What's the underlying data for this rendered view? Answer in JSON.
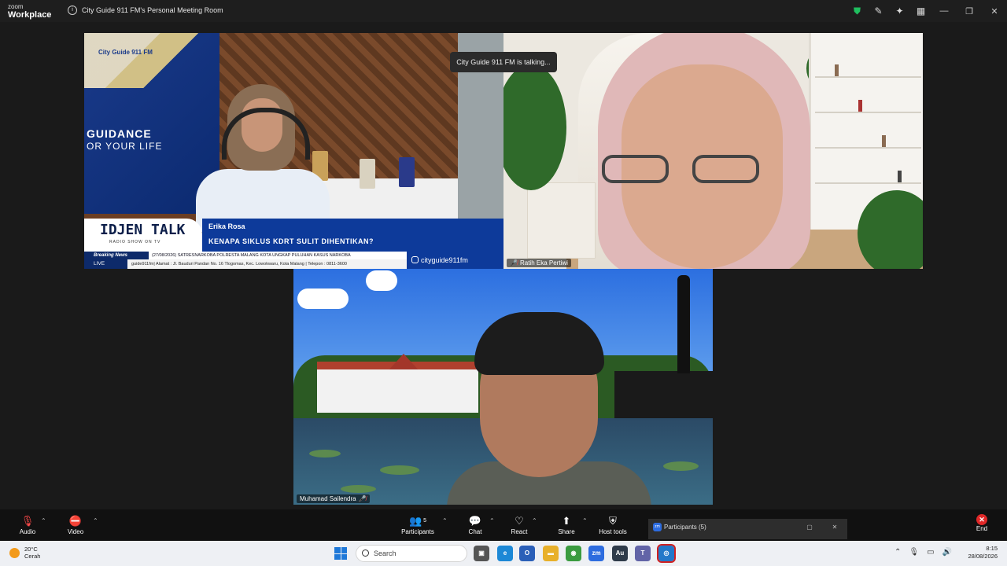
{
  "app": {
    "logo_line1": "zoom",
    "logo_line2": "Workplace",
    "meeting_title": "City Guide 911 FM's Personal Meeting Room"
  },
  "toast": {
    "text": "City Guide 911 FM is talking..."
  },
  "tiles": [
    {
      "name": "",
      "overlay": {
        "banner_brand": "City Guide 911 FM",
        "banner_line1": "GUIDANCE",
        "banner_line2": "OR YOUR LIFE",
        "show_logo": "IDJEN TALK",
        "show_sub": "RADIO SHOW ON TV",
        "speaker": "Erika Rosa",
        "topic": "KENAPA SIKLUS KDRT SULIT DIHENTIKAN?",
        "breaking_label": "Breaking News",
        "ticker1": "(27/08/2026) SATRESNARKOBA POLRESTA MALANG KOTA UNGKAP PULUHAN KASUS NARKOBA",
        "ticker2": "guide911fm| Alamat : Jl. Bauduri Pandan No. 16 Tlogomas, Kec. Lowokwaru, Kota Malang | Telepon : 0811-3600",
        "live_label": "LIVE",
        "social": "cityguide911fm"
      }
    },
    {
      "name": "Ratih Eka Pertiwi",
      "muted": true
    },
    {
      "name": "Muhamad Sailendra",
      "muted": true
    }
  ],
  "controls": {
    "audio": "Audio",
    "video": "Video",
    "participants": "Participants",
    "participants_count": "5",
    "chat": "Chat",
    "react": "React",
    "share": "Share",
    "host_tools": "Host tools",
    "end": "End"
  },
  "participants_panel": {
    "title": "Participants (5)"
  },
  "taskbar": {
    "temperature": "20°C",
    "condition": "Cerah",
    "search_placeholder": "Search",
    "time": "8:15",
    "date": "28/08/2026"
  },
  "colors": {
    "background": "#1a1a1a",
    "accent": "#2d6cdf",
    "end": "#e02828",
    "security": "#1fbf5f"
  }
}
